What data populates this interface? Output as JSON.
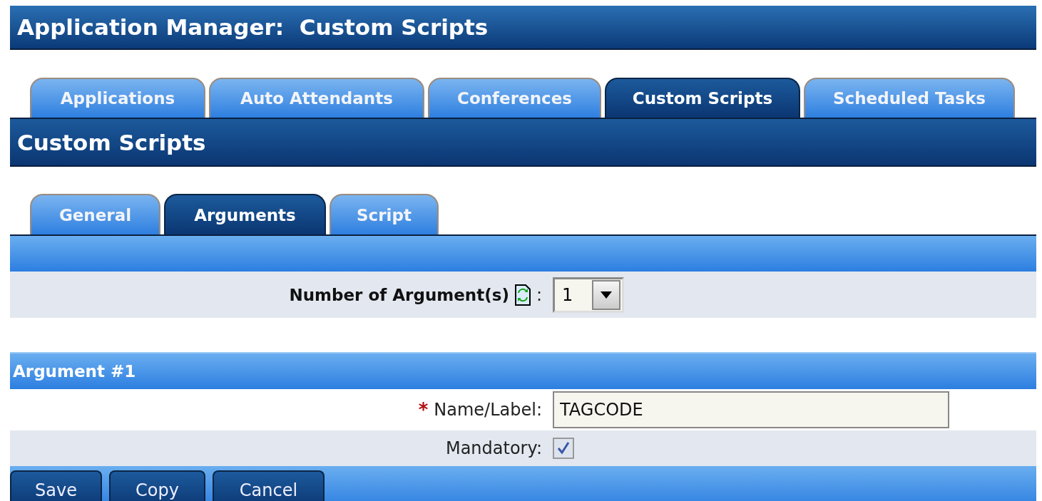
{
  "page_title": "Application Manager:  Custom Scripts",
  "tabs": [
    {
      "label": "Applications",
      "selected": false
    },
    {
      "label": "Auto Attendants",
      "selected": false
    },
    {
      "label": "Conferences",
      "selected": false
    },
    {
      "label": "Custom Scripts",
      "selected": true
    },
    {
      "label": "Scheduled Tasks",
      "selected": false
    }
  ],
  "section_title": "Custom Scripts",
  "subtabs": [
    {
      "label": "General",
      "selected": false
    },
    {
      "label": "Arguments",
      "selected": true
    },
    {
      "label": "Script",
      "selected": false
    }
  ],
  "argument_count": {
    "label": "Number of Argument(s)",
    "colon": ":",
    "value": "1"
  },
  "argument": {
    "header": "Argument #1",
    "required_mark": "*",
    "name_label": "Name/Label:",
    "name_value": "TAGCODE",
    "mandatory_label": "Mandatory:",
    "mandatory_checked": true
  },
  "buttons": [
    "Save",
    "Copy",
    "Cancel"
  ]
}
